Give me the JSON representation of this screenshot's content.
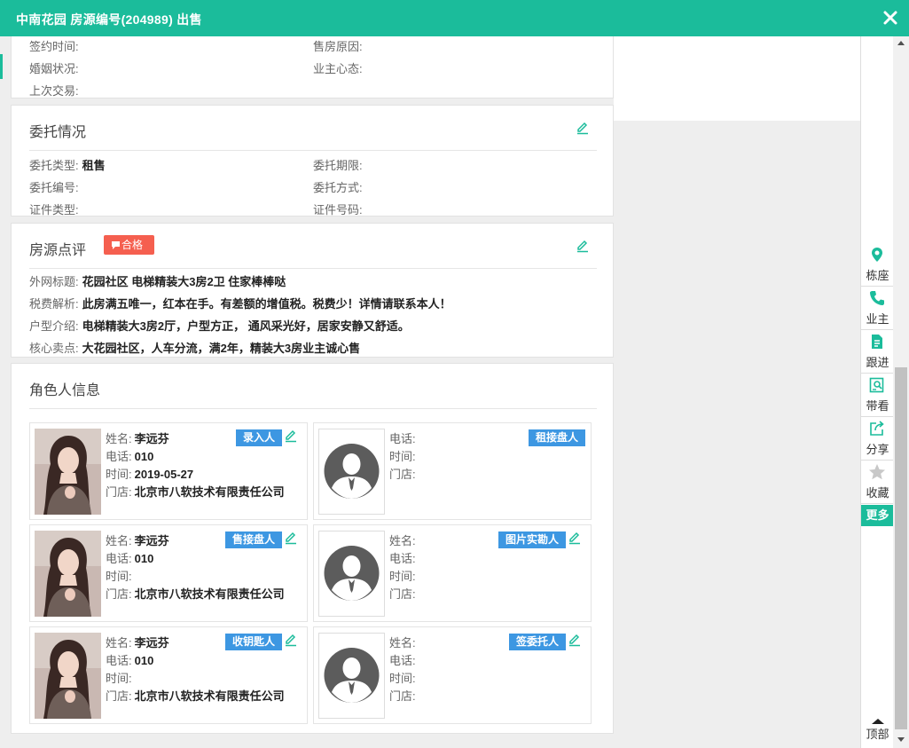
{
  "window": {
    "title": "中南花园 房源编号(204989) 出售"
  },
  "top_info": {
    "sign_time": {
      "label": "签约时间:",
      "value": ""
    },
    "sell_reason": {
      "label": "售房原因:",
      "value": ""
    },
    "marital": {
      "label": "婚姻状况:",
      "value": ""
    },
    "owner_mind": {
      "label": "业主心态:",
      "value": ""
    },
    "last_trade": {
      "label": "上次交易:",
      "value": ""
    }
  },
  "entrust": {
    "title": "委托情况",
    "type": {
      "label": "委托类型:",
      "value": "租售"
    },
    "period": {
      "label": "委托期限:",
      "value": ""
    },
    "number": {
      "label": "委托编号:",
      "value": ""
    },
    "method": {
      "label": "委托方式:",
      "value": ""
    },
    "cert_type": {
      "label": "证件类型:",
      "value": ""
    },
    "cert_no": {
      "label": "证件号码:",
      "value": ""
    }
  },
  "review": {
    "title": "房源点评",
    "badge": "合格",
    "web_title": {
      "label": "外网标题:",
      "value": "花园社区 电梯精装大3房2卫 住家棒棒哒"
    },
    "tax": {
      "label": "税费解析:",
      "value": "此房满五唯一，红本在手。有差额的增值税。税费少！详情请联系本人！"
    },
    "layout": {
      "label": "户型介绍:",
      "value": "电梯精装大3房2厅，户型方正， 通风采光好，居家安静又舒适。"
    },
    "selling": {
      "label": "核心卖点:",
      "value": "大花园社区，人车分流，满2年，精装大3房业主诚心售"
    }
  },
  "roles": {
    "title": "角色人信息",
    "labels": {
      "name": "姓名:",
      "phone": "电话:",
      "time": "时间:",
      "store": "门店:"
    },
    "cards": [
      {
        "role": "录入人",
        "name": "李远芬",
        "phone": "010",
        "time": "2019-05-27",
        "store": "北京市八软技术有限责任公司",
        "has_photo": true
      },
      {
        "role": "租接盘人",
        "name": "",
        "phone": "",
        "time": "",
        "store": "",
        "has_photo": false
      },
      {
        "role": "售接盘人",
        "name": "李远芬",
        "phone": "010",
        "time": "",
        "store": "北京市八软技术有限责任公司",
        "has_photo": true
      },
      {
        "role": "图片实勘人",
        "name": "",
        "phone": "",
        "time": "",
        "store": "",
        "has_photo": false
      },
      {
        "role": "收钥匙人",
        "name": "李远芬",
        "phone": "010",
        "time": "",
        "store": "北京市八软技术有限责任公司",
        "has_photo": true
      },
      {
        "role": "签委托人",
        "name": "",
        "phone": "",
        "time": "",
        "store": "",
        "has_photo": false
      }
    ]
  },
  "toolbar": {
    "building": "栋座",
    "owner": "业主",
    "follow": "跟进",
    "viewing": "带看",
    "share": "分享",
    "favorite": "收藏",
    "more": "更多",
    "top": "顶部"
  },
  "colors": {
    "primary": "#1bbc9b",
    "badge": "#f55f4f",
    "role_tag": "#3d97e2"
  }
}
